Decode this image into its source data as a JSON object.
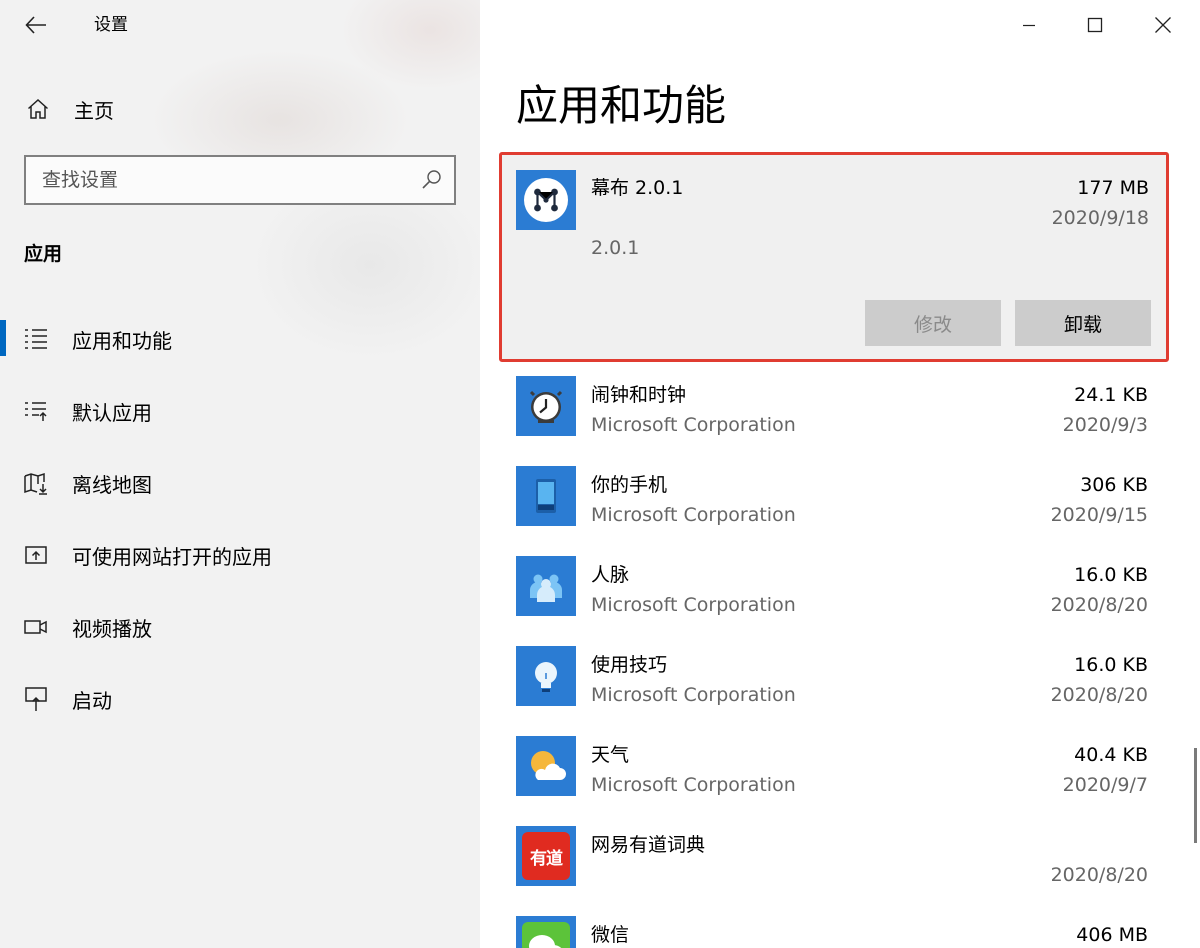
{
  "window": {
    "title": "设置",
    "controls": [
      "minimize",
      "maximize",
      "close"
    ]
  },
  "sidebar": {
    "home_label": "主页",
    "search_placeholder": "查找设置",
    "section_title": "应用",
    "items": [
      {
        "label": "应用和功能",
        "icon": "apps-features-icon",
        "selected": true
      },
      {
        "label": "默认应用",
        "icon": "default-apps-icon",
        "selected": false
      },
      {
        "label": "离线地图",
        "icon": "offline-maps-icon",
        "selected": false
      },
      {
        "label": "可使用网站打开的应用",
        "icon": "apps-for-websites-icon",
        "selected": false
      },
      {
        "label": "视频播放",
        "icon": "video-playback-icon",
        "selected": false
      },
      {
        "label": "启动",
        "icon": "startup-icon",
        "selected": false
      }
    ]
  },
  "main": {
    "title": "应用和功能",
    "selected_app": {
      "name": "幕布 2.0.1",
      "size": "177 MB",
      "date": "2020/9/18",
      "version": "2.0.1",
      "modify_label": "修改",
      "uninstall_label": "卸载"
    },
    "apps": [
      {
        "name": "闹钟和时钟",
        "publisher": "Microsoft Corporation",
        "size": "24.1 KB",
        "date": "2020/9/3",
        "icon": "alarm-clock-icon"
      },
      {
        "name": "你的手机",
        "publisher": "Microsoft Corporation",
        "size": "306 KB",
        "date": "2020/9/15",
        "icon": "phone-icon"
      },
      {
        "name": "人脉",
        "publisher": "Microsoft Corporation",
        "size": "16.0 KB",
        "date": "2020/8/20",
        "icon": "people-icon"
      },
      {
        "name": "使用技巧",
        "publisher": "Microsoft Corporation",
        "size": "16.0 KB",
        "date": "2020/8/20",
        "icon": "lightbulb-icon"
      },
      {
        "name": "天气",
        "publisher": "Microsoft Corporation",
        "size": "40.4 KB",
        "date": "2020/9/7",
        "icon": "weather-icon"
      },
      {
        "name": "网易有道词典",
        "publisher": "",
        "size": "",
        "date": "2020/8/20",
        "icon": "youdao-icon",
        "icon_text": "有道"
      },
      {
        "name": "微信",
        "publisher": "",
        "size": "406 MB",
        "date": "",
        "icon": "wechat-icon"
      }
    ]
  },
  "colors": {
    "accent": "#0067c0",
    "highlight_border": "#e03c31",
    "app_tile": "#2b7cd3",
    "youdao_red": "#e02b20",
    "wechat_green": "#5cc33a"
  }
}
